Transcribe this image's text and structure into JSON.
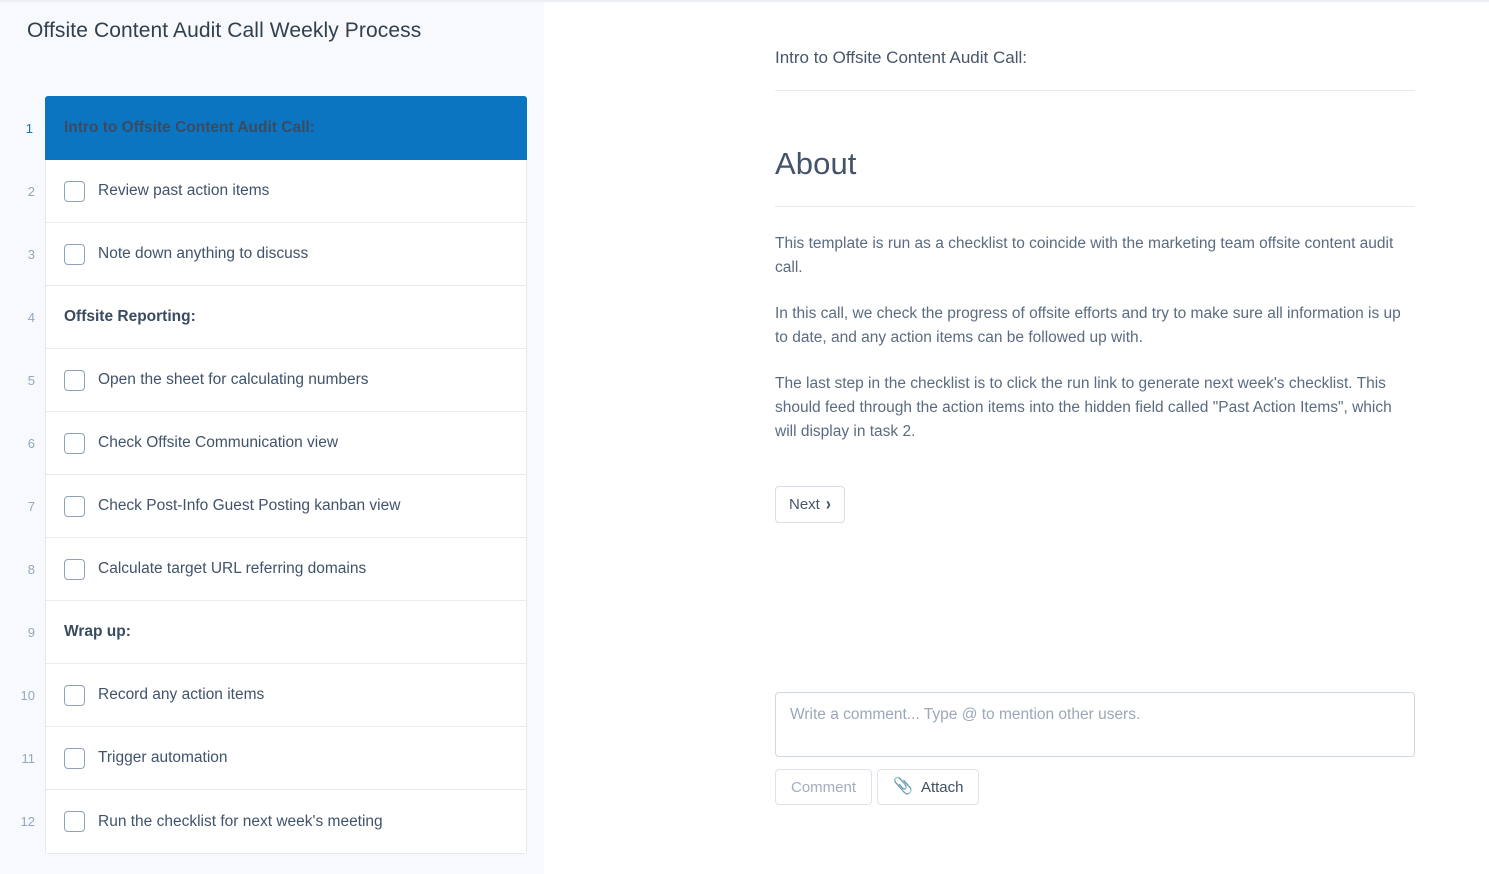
{
  "checklist": {
    "title": "Offsite Content Audit Call Weekly Process",
    "tasks": [
      {
        "num": "1",
        "label": "Intro to Offsite Content Audit Call:",
        "type": "header",
        "active": true
      },
      {
        "num": "2",
        "label": "Review past action items",
        "type": "task",
        "active": false
      },
      {
        "num": "3",
        "label": "Note down anything to discuss",
        "type": "task",
        "active": false
      },
      {
        "num": "4",
        "label": "Offsite Reporting:",
        "type": "header",
        "active": false
      },
      {
        "num": "5",
        "label": "Open the sheet for calculating numbers",
        "type": "task",
        "active": false
      },
      {
        "num": "6",
        "label": "Check Offsite Communication view",
        "type": "task",
        "active": false
      },
      {
        "num": "7",
        "label": "Check Post-Info Guest Posting kanban view",
        "type": "task",
        "active": false
      },
      {
        "num": "8",
        "label": "Calculate target URL referring domains",
        "type": "task",
        "active": false
      },
      {
        "num": "9",
        "label": "Wrap up:",
        "type": "header",
        "active": false
      },
      {
        "num": "10",
        "label": "Record any action items",
        "type": "task",
        "active": false
      },
      {
        "num": "11",
        "label": "Trigger automation",
        "type": "task",
        "active": false
      },
      {
        "num": "12",
        "label": "Run the checklist for next week's meeting",
        "type": "task",
        "active": false
      }
    ]
  },
  "detail": {
    "step_title": "Intro to Offsite Content Audit Call:",
    "about_heading": "About",
    "paragraphs": [
      "This template is run as a checklist to coincide with the marketing team offsite content audit call.",
      "In this call, we check the progress of offsite efforts and try to make sure all information is up to date, and any action items can be followed up with.",
      "The last step in the checklist is to click the run link to generate next week's checklist. This should feed through the action items into the hidden field called \"Past Action Items\", which will display in task 2."
    ],
    "next_label": "Next",
    "next_chevron": "›"
  },
  "comments": {
    "placeholder": "Write a comment... Type @ to mention other users.",
    "value": "",
    "comment_label": "Comment",
    "attach_label": "Attach",
    "attach_icon": "📎"
  },
  "colors": {
    "accent_blue": "#0c75c2",
    "panel_bg": "#f7f9fc",
    "text_dark": "#41536b",
    "text_muted": "#5b6b80",
    "border": "#e4e9ef"
  }
}
